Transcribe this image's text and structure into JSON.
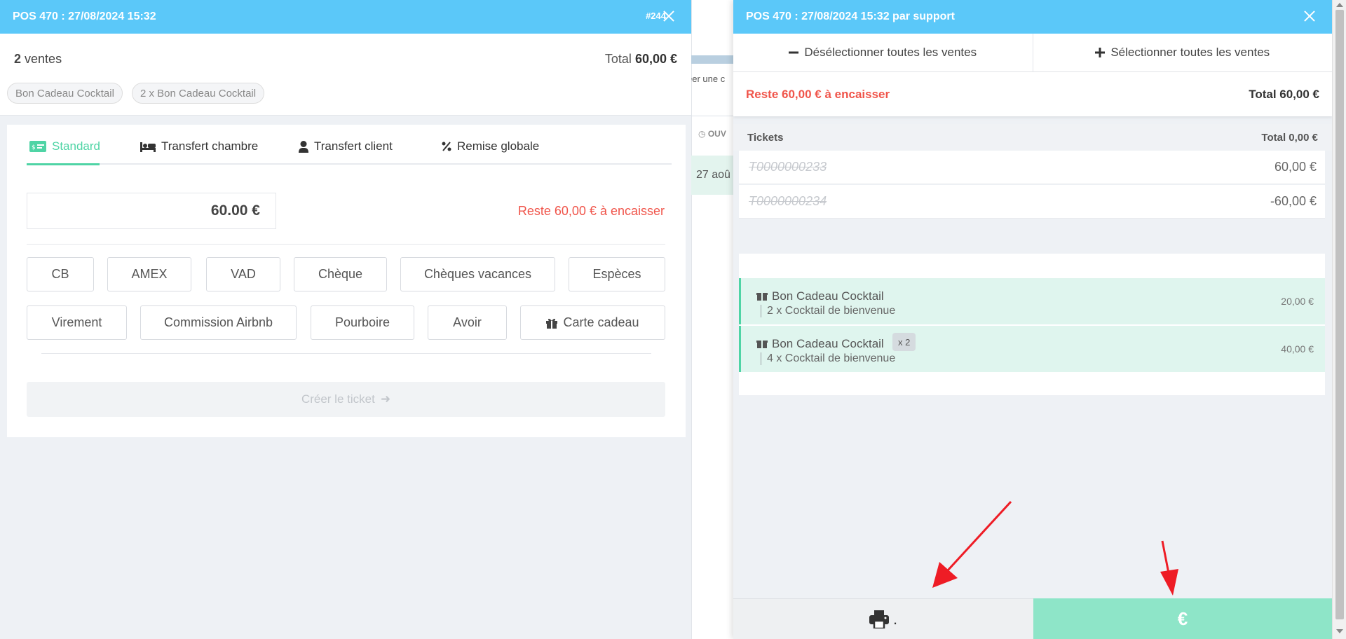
{
  "left_panel": {
    "title": "POS 470 : 27/08/2024 15:32",
    "ref": "#244",
    "sale_count": "2",
    "sale_count_label": "ventes",
    "total_label": "Total",
    "total_value": "60,00 €",
    "chips": [
      "Bon Cadeau Cocktail",
      "2 x Bon Cadeau Cocktail"
    ],
    "tabs": [
      {
        "label": "Standard",
        "icon": "card-icon",
        "active": true
      },
      {
        "label": "Transfert chambre",
        "icon": "bed-icon"
      },
      {
        "label": "Transfert client",
        "icon": "user-icon"
      },
      {
        "label": "Remise globale",
        "icon": "percent-icon"
      }
    ],
    "amount": "60.00 €",
    "remaining": "Reste 60,00 € à encaisser",
    "payment_methods": [
      "CB",
      "AMEX",
      "VAD",
      "Chèque",
      "Chèques vacances",
      "Espèces",
      "Virement",
      "Commission Airbnb",
      "Pourboire",
      "Avoir",
      "Carte cadeau"
    ],
    "create_ticket": "Créer le ticket"
  },
  "background": {
    "create_text": "éer une c",
    "column_header": "OUV",
    "date_text": "27 aoû"
  },
  "right_panel": {
    "title": "POS 470 : 27/08/2024 15:32 par support",
    "deselect_all": "Désélectionner toutes les ventes",
    "select_all": "Sélectionner toutes les ventes",
    "remaining": "Reste 60,00 € à encaisser",
    "total": "Total 60,00 €",
    "tickets_label": "Tickets",
    "tickets_total": "Total 0,00 €",
    "tickets": [
      {
        "id": "T0000000233",
        "amount": "60,00 €"
      },
      {
        "id": "T0000000234",
        "amount": "-60,00 €"
      }
    ],
    "items": [
      {
        "title": "Bon Cadeau Cocktail",
        "detail": "2 x Cocktail de bienvenue",
        "price": "20,00 €"
      },
      {
        "title": "Bon Cadeau Cocktail",
        "detail": "4 x Cocktail de bienvenue",
        "price": "40,00 €",
        "qty": "x 2"
      }
    ],
    "print_suffix": ".",
    "pay_symbol": "€"
  },
  "colors": {
    "header": "#5bc8f9",
    "accent": "#4fd4a5",
    "alert": "#f0554b",
    "pay_button": "#8ee5c8",
    "arrow": "#ee1c25"
  }
}
